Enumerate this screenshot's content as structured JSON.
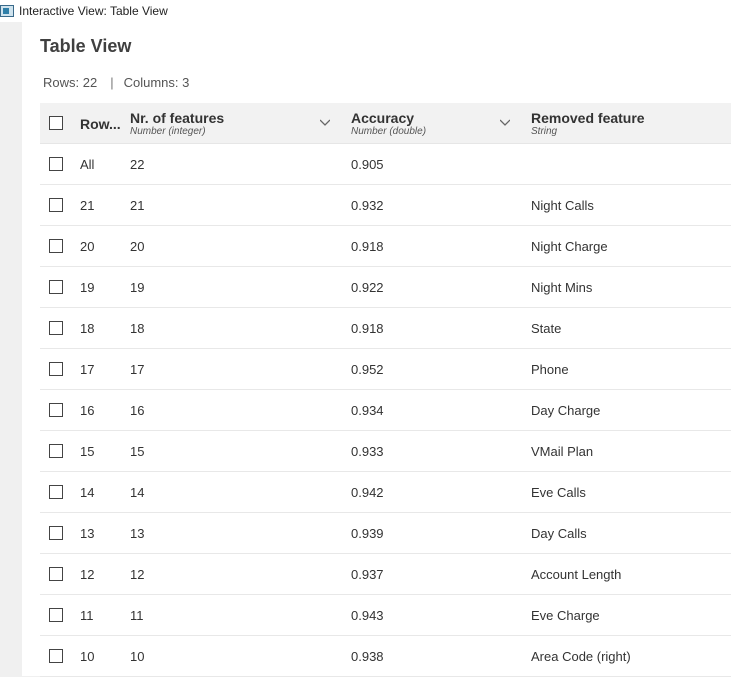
{
  "window": {
    "title": "Interactive View: Table View"
  },
  "view": {
    "title": "Table View",
    "rows_label": "Rows: 22",
    "separator": "|",
    "columns_label": "Columns: 3"
  },
  "table": {
    "columns": [
      {
        "name": "Row...",
        "type": ""
      },
      {
        "name": "Nr. of features",
        "type": "Number (integer)"
      },
      {
        "name": "Accuracy",
        "type": "Number (double)"
      },
      {
        "name": "Removed feature",
        "type": "String"
      }
    ],
    "rows": [
      {
        "row": "All",
        "nr_features": "22",
        "accuracy": "0.905",
        "removed": ""
      },
      {
        "row": "21",
        "nr_features": "21",
        "accuracy": "0.932",
        "removed": "Night Calls"
      },
      {
        "row": "20",
        "nr_features": "20",
        "accuracy": "0.918",
        "removed": "Night Charge"
      },
      {
        "row": "19",
        "nr_features": "19",
        "accuracy": "0.922",
        "removed": "Night Mins"
      },
      {
        "row": "18",
        "nr_features": "18",
        "accuracy": "0.918",
        "removed": "State"
      },
      {
        "row": "17",
        "nr_features": "17",
        "accuracy": "0.952",
        "removed": "Phone"
      },
      {
        "row": "16",
        "nr_features": "16",
        "accuracy": "0.934",
        "removed": "Day Charge"
      },
      {
        "row": "15",
        "nr_features": "15",
        "accuracy": "0.933",
        "removed": "VMail Plan"
      },
      {
        "row": "14",
        "nr_features": "14",
        "accuracy": "0.942",
        "removed": "Eve Calls"
      },
      {
        "row": "13",
        "nr_features": "13",
        "accuracy": "0.939",
        "removed": "Day Calls"
      },
      {
        "row": "12",
        "nr_features": "12",
        "accuracy": "0.937",
        "removed": "Account Length"
      },
      {
        "row": "11",
        "nr_features": "11",
        "accuracy": "0.943",
        "removed": "Eve Charge"
      },
      {
        "row": "10",
        "nr_features": "10",
        "accuracy": "0.938",
        "removed": "Area Code (right)"
      }
    ]
  }
}
